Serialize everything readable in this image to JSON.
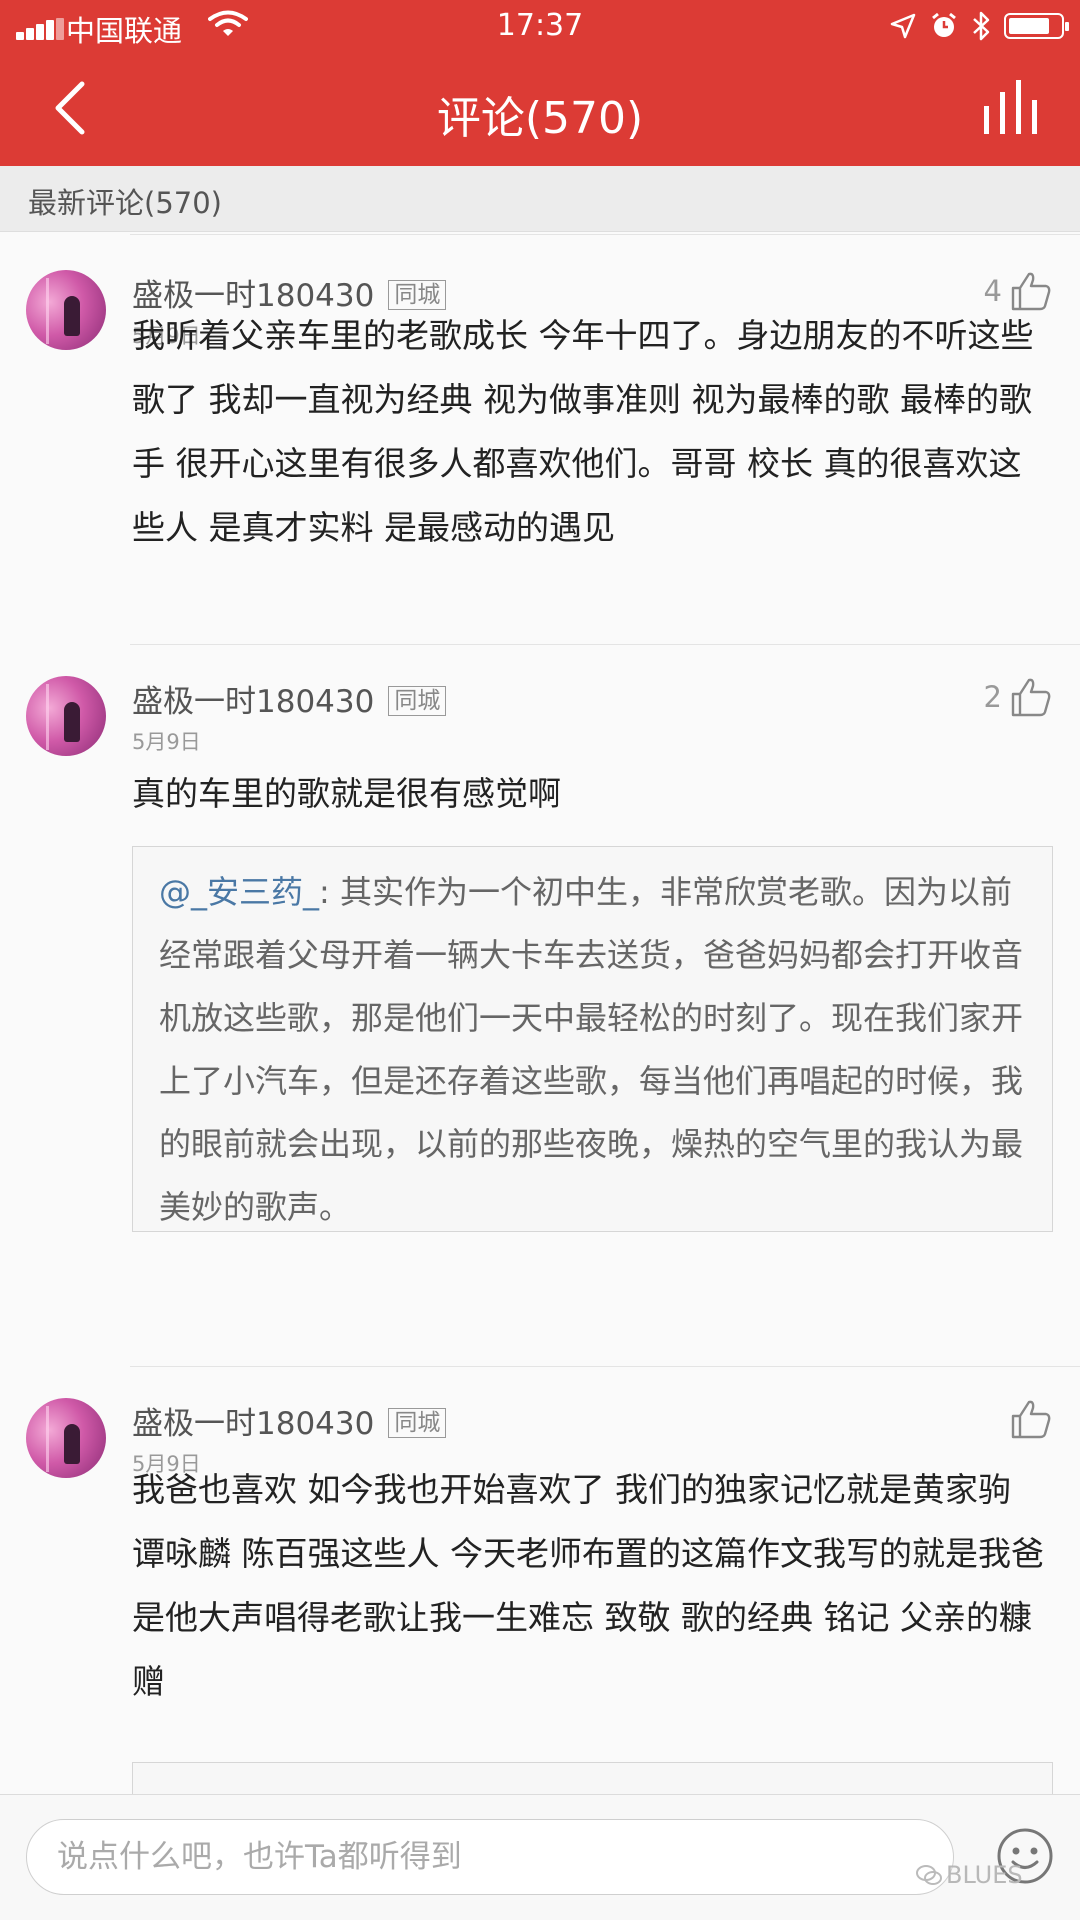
{
  "status_bar": {
    "carrier": "中国联通",
    "time": "17:37"
  },
  "header": {
    "title": "评论(570)",
    "back_icon": "back-chevron-icon",
    "menu_icon": "equalizer-icon"
  },
  "section_header": "最新评论(570)",
  "comments": [
    {
      "username": "盛极一时180430",
      "badge": "同城",
      "date": "5月9日",
      "likes": "4",
      "text": "我听着父亲车里的老歌成长 今年十四了。身边朋友的不听这些歌了 我却一直视为经典 视为做事准则 视为最棒的歌 最棒的歌手 很开心这里有很多人都喜欢他们。哥哥 校长 真的很喜欢这些人 是真才实料 是最感动的遇见"
    },
    {
      "username": "盛极一时180430",
      "badge": "同城",
      "date": "5月9日",
      "likes": "2",
      "text": "真的车里的歌就是很有感觉啊",
      "quote": {
        "author": "@_安三药_",
        "text": ": 其实作为一个初中生，非常欣赏老歌。因为以前经常跟着父母开着一辆大卡车去送货，爸爸妈妈都会打开收音机放这些歌，那是他们一天中最轻松的时刻了。现在我们家开上了小汽车，但是还存着这些歌，每当他们再唱起的时候，我的眼前就会出现，以前的那些夜晚，燥热的空气里的我认为最美妙的歌声。"
      }
    },
    {
      "username": "盛极一时180430",
      "badge": "同城",
      "date": "5月9日",
      "likes": "",
      "text": "我爸也喜欢 如今我也开始喜欢了 我们的独家记忆就是黄家驹 谭咏麟 陈百强这些人 今天老师布置的这篇作文我写的就是我爸 是他大声唱得老歌让我一生难忘 致敬 歌的经典  铭记 父亲的糠赠"
    }
  ],
  "input": {
    "placeholder": "说点什么吧，也许Ta都听得到"
  },
  "watermark": "BLUES"
}
